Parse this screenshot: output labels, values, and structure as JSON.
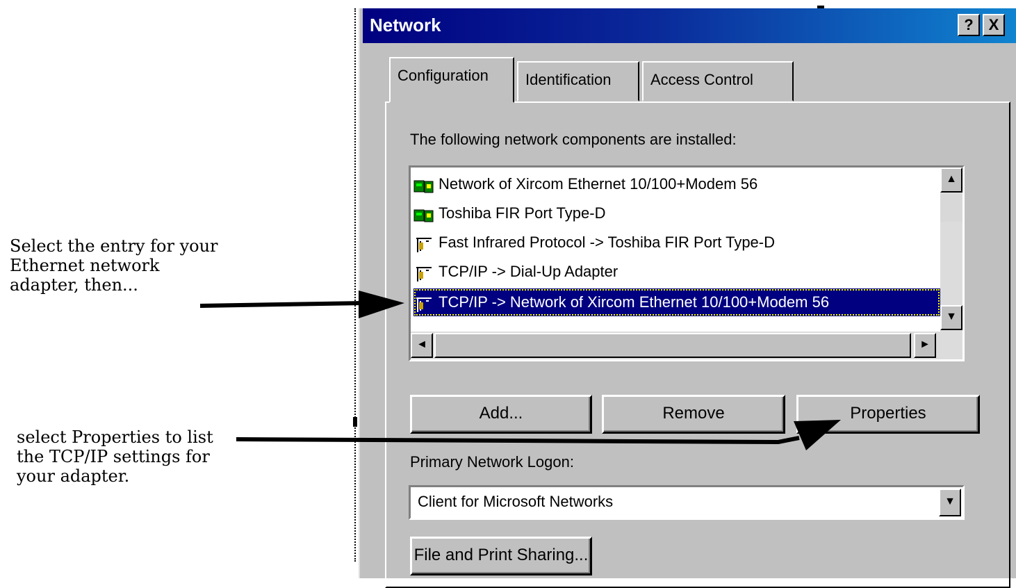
{
  "annotations": {
    "select_entry": "Select the entry for your Ethernet network adapter, then...",
    "select_properties": "select Properties to list the TCP/IP settings for your adapter."
  },
  "window": {
    "title": "Network",
    "help_glyph": "?",
    "close_glyph": "X"
  },
  "tabs": [
    {
      "label": "Configuration",
      "active": true
    },
    {
      "label": "Identification",
      "active": false
    },
    {
      "label": "Access Control",
      "active": false
    }
  ],
  "components_label": "The following network components are installed:",
  "components": [
    {
      "label": "Network of Xircom Ethernet 10/100+Modem 56",
      "icon": "adapter-icon",
      "selected": false
    },
    {
      "label": "Toshiba FIR Port Type-D",
      "icon": "adapter-icon",
      "selected": false
    },
    {
      "label": "Fast Infrared Protocol -> Toshiba FIR Port Type-D",
      "icon": "protocol-icon",
      "selected": false
    },
    {
      "label": "TCP/IP -> Dial-Up Adapter",
      "icon": "protocol-icon",
      "selected": false
    },
    {
      "label": "TCP/IP -> Network of Xircom Ethernet 10/100+Modem 56",
      "icon": "protocol-icon",
      "selected": true
    }
  ],
  "buttons": {
    "add": "Add...",
    "remove": "Remove",
    "properties": "Properties",
    "file_print_sharing": "File and Print Sharing..."
  },
  "logon_label": "Primary Network Logon:",
  "logon_value": "Client for Microsoft Networks",
  "colors": {
    "title_bar": "#000080",
    "selection": "#000080",
    "face": "#c0c0c0"
  }
}
